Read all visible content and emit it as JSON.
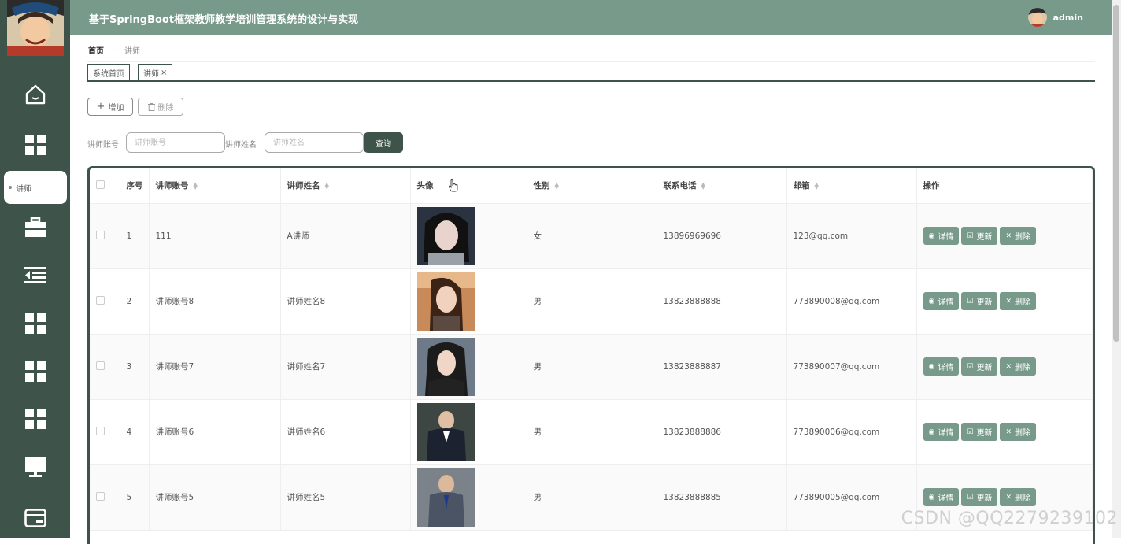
{
  "app": {
    "title": "基于SpringBoot框架教师教学培训管理系统的设计与实现",
    "user": "admin"
  },
  "sidebar": {
    "active_label": "讲师",
    "icons": [
      "home-icon",
      "grid-icon",
      "briefcase-icon",
      "indent-list-icon",
      "grid-icon",
      "grid-icon",
      "grid-icon",
      "monitor-icon",
      "card-icon"
    ]
  },
  "breadcrumb": {
    "home": "首页",
    "current": "讲师"
  },
  "tabs": [
    {
      "label": "系统首页"
    },
    {
      "label": "讲师",
      "close": "×"
    }
  ],
  "toolbar": {
    "add_label": "增加",
    "delete_label": "删除"
  },
  "filters": {
    "account_label": "讲师账号",
    "account_placeholder": "讲师账号",
    "name_label": "讲师姓名",
    "name_placeholder": "讲师姓名",
    "query_label": "查询"
  },
  "table": {
    "columns": [
      "序号",
      "讲师账号",
      "讲师姓名",
      "头像",
      "性别",
      "联系电话",
      "邮箱",
      "操作"
    ],
    "actions": {
      "detail": "详情",
      "update": "更新",
      "delete": "删除"
    },
    "rows": [
      {
        "index": "1",
        "account": "111",
        "name": "A讲师",
        "gender": "女",
        "phone": "13896969696",
        "email": "123@qq.com"
      },
      {
        "index": "2",
        "account": "讲师账号8",
        "name": "讲师姓名8",
        "gender": "男",
        "phone": "13823888888",
        "email": "773890008@qq.com"
      },
      {
        "index": "3",
        "account": "讲师账号7",
        "name": "讲师姓名7",
        "gender": "男",
        "phone": "13823888887",
        "email": "773890007@qq.com"
      },
      {
        "index": "4",
        "account": "讲师账号6",
        "name": "讲师姓名6",
        "gender": "男",
        "phone": "13823888886",
        "email": "773890006@qq.com"
      },
      {
        "index": "5",
        "account": "讲师账号5",
        "name": "讲师姓名5",
        "gender": "男",
        "phone": "13823888885",
        "email": "773890005@qq.com"
      }
    ]
  },
  "watermark": "CSDN @QQ2279239102",
  "colors": {
    "sidebar": "#3e534a",
    "header": "#779a8b",
    "action": "#779a8b"
  }
}
